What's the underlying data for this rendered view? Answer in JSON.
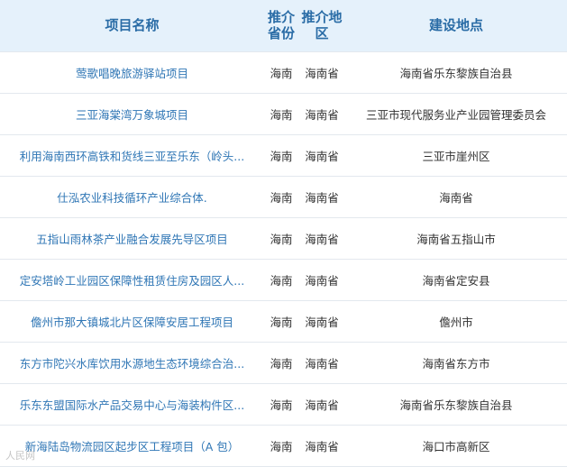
{
  "table": {
    "headers": {
      "name": "项目名称",
      "province_l1": "推介",
      "province_l2": "省份",
      "area_l1": "推介地",
      "area_l2": "区",
      "location": "建设地点"
    },
    "rows": [
      {
        "name": "莺歌唱晚旅游驿站项目",
        "province": "海南",
        "area": "海南省",
        "location": "海南省乐东黎族自治县"
      },
      {
        "name": "三亚海棠湾万象城项目",
        "province": "海南",
        "area": "海南省",
        "location": "三亚市现代服务业产业园管理委员会"
      },
      {
        "name": "利用海南西环高铁和货线三亚至乐东（岭头...",
        "province": "海南",
        "area": "海南省",
        "location": "三亚市崖州区"
      },
      {
        "name": "仕泓农业科技循环产业综合体.",
        "province": "海南",
        "area": "海南省",
        "location": "海南省"
      },
      {
        "name": "五指山雨林茶产业融合发展先导区项目",
        "province": "海南",
        "area": "海南省",
        "location": "海南省五指山市"
      },
      {
        "name": "定安塔岭工业园区保障性租赁住房及园区人...",
        "province": "海南",
        "area": "海南省",
        "location": "海南省定安县"
      },
      {
        "name": "儋州市那大镇城北片区保障安居工程项目",
        "province": "海南",
        "area": "海南省",
        "location": "儋州市"
      },
      {
        "name": "东方市陀兴水库饮用水源地生态环境综合治...",
        "province": "海南",
        "area": "海南省",
        "location": "海南省东方市"
      },
      {
        "name": "乐东东盟国际水产品交易中心与海装构件区...",
        "province": "海南",
        "area": "海南省",
        "location": "海南省乐东黎族自治县"
      },
      {
        "name": "新海陆岛物流园区起步区工程项目（A 包）",
        "province": "海南",
        "area": "海南省",
        "location": "海口市高新区"
      }
    ]
  },
  "watermark": "人民网"
}
